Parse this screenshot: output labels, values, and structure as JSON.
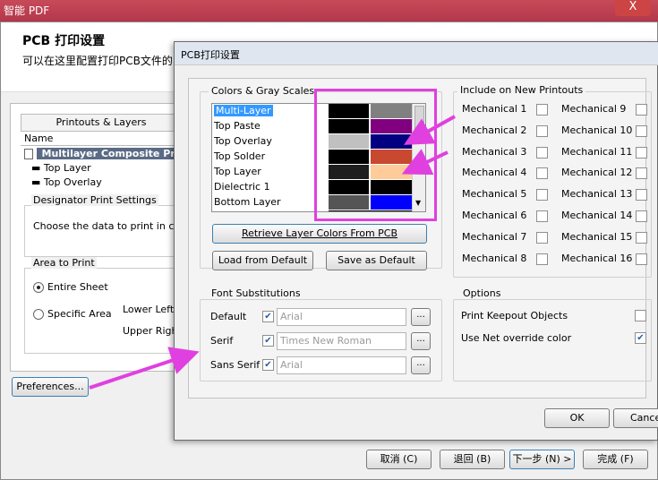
{
  "window": {
    "title": "智能 PDF",
    "close": "X"
  },
  "wizard": {
    "heading": "PCB 打印设置",
    "subheading": "可以在这里配置打印PCB文件的",
    "printouts_header": "Printouts & Layers",
    "name_header": "Name",
    "tree": [
      "Multilayer Composite Print",
      "Top Layer",
      "Top Overlay"
    ],
    "designator_title": "Designator Print Settings",
    "designator_text": "Choose the data to print in co",
    "area_title": "Area to Print",
    "entire_sheet": "Entire Sheet",
    "specific_area": "Specific Area",
    "lower_left": "Lower Left",
    "upper_right": "Upper Righ",
    "preferences": "Preferences...",
    "buttons": {
      "cancel": "取消 (C)",
      "back": "退回 (B)",
      "next": "下一步 (N) >",
      "finish": "完成 (F)"
    }
  },
  "dialog": {
    "title": "PCB打印设置",
    "colors_label": "Colors & Gray Scales",
    "layers": [
      {
        "name": "Multi-Layer",
        "c1": "#000000",
        "c2": "#808080"
      },
      {
        "name": "Top Paste",
        "c1": "#000000",
        "c2": "#800080"
      },
      {
        "name": "Top Overlay",
        "c1": "#c0c0c0",
        "c2": "#000080"
      },
      {
        "name": "Top Solder",
        "c1": "#000000",
        "c2": "#c8492f"
      },
      {
        "name": "Top Layer",
        "c1": "#1e1e1e",
        "c2": "#ffcc99"
      },
      {
        "name": "Dielectric 1",
        "c1": "#000000",
        "c2": "#000000"
      },
      {
        "name": "Bottom Layer",
        "c1": "#555555",
        "c2": "#0000ff"
      }
    ],
    "retrieve": "Retrieve Layer Colors From PCB",
    "load_default": "Load from Default",
    "save_default": "Save as Default",
    "include_label": "Include on New Printouts",
    "mech_left": [
      "Mechanical 1",
      "Mechanical 2",
      "Mechanical 3",
      "Mechanical 4",
      "Mechanical 5",
      "Mechanical 6",
      "Mechanical 7",
      "Mechanical 8"
    ],
    "mech_right": [
      "Mechanical 9",
      "Mechanical 10",
      "Mechanical 11",
      "Mechanical 12",
      "Mechanical 13",
      "Mechanical 14",
      "Mechanical 15",
      "Mechanical 16"
    ],
    "font_label": "Font Substitutions",
    "fonts": [
      {
        "label": "Default",
        "value": "Arial",
        "checked": true
      },
      {
        "label": "Serif",
        "value": "Times New Roman",
        "checked": true
      },
      {
        "label": "Sans Serif",
        "value": "Arial",
        "checked": true
      }
    ],
    "dots": "...",
    "options_label": "Options",
    "opt_keepout": "Print Keepout Objects",
    "opt_net": "Use Net override color",
    "ok": "OK",
    "cancel": "Cance"
  },
  "colors": {
    "highlight": "#e040e0",
    "selection": "#3399ff"
  }
}
